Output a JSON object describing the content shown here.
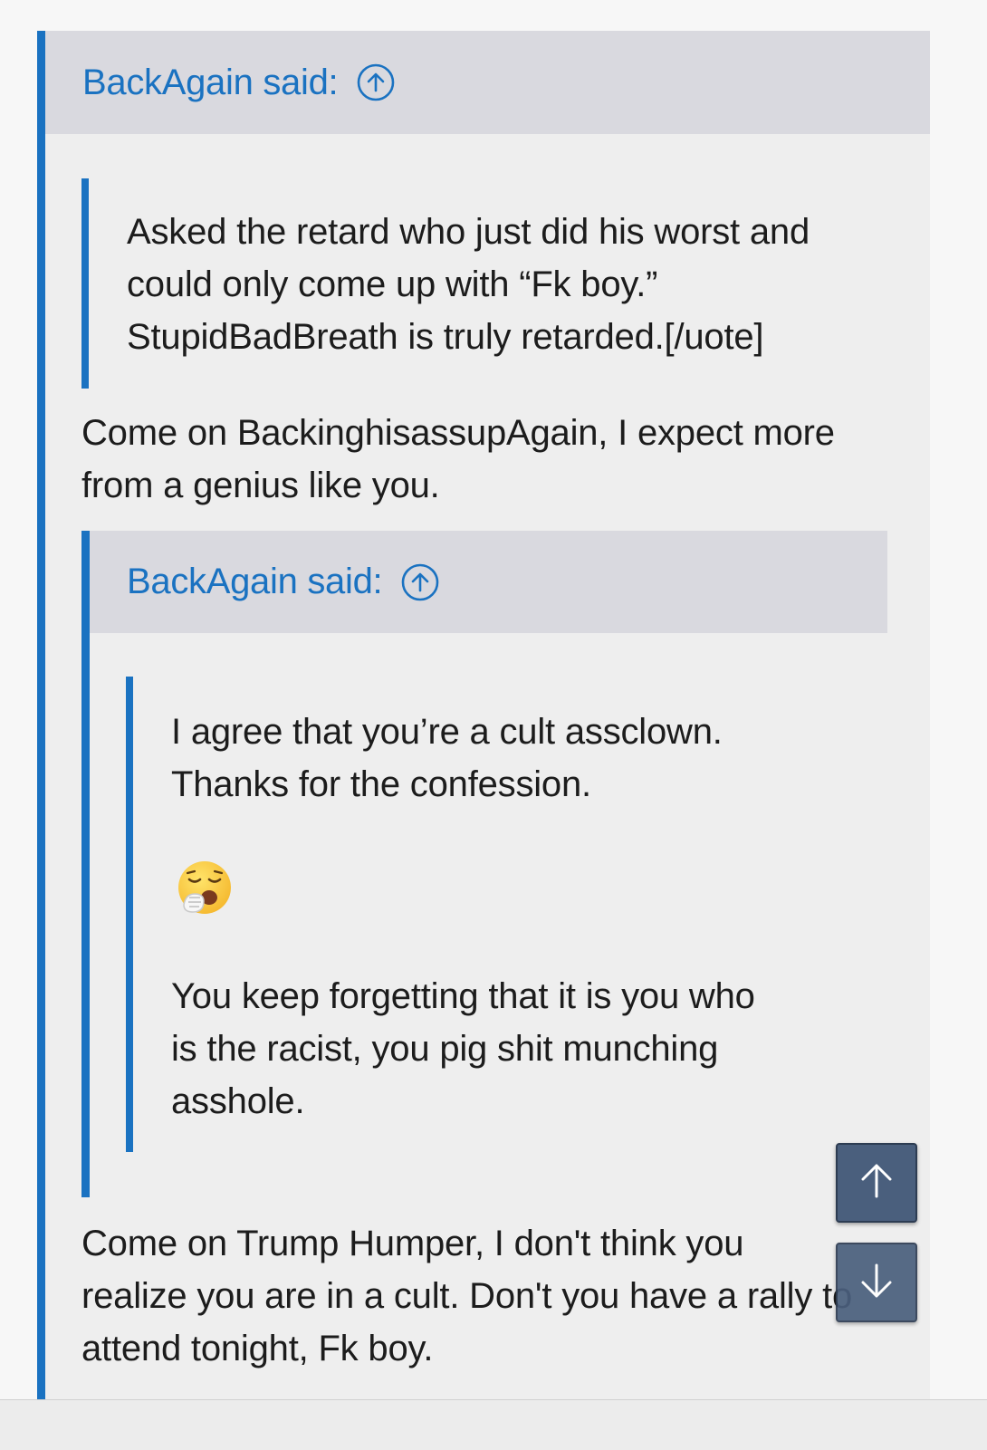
{
  "outer_quote": {
    "author_label": "BackAgain said:",
    "jump_icon": "arrow-up-circle-icon"
  },
  "inner_quote_1": {
    "text": "Asked the retard who just did his worst and\ncould only come up with “Fk boy.”\nStupidBadBreath is truly retarded.[/uote]"
  },
  "paragraph_1": "Come on BackinghisassupAgain, I expect more\nfrom a genius like you.",
  "nested_quote": {
    "author_label": "BackAgain said:",
    "jump_icon": "arrow-up-circle-icon",
    "inner": {
      "text_1": "I agree that you’re a cult assclown.\nThanks for the confession.",
      "emoji": "yawning-face-emoji",
      "text_2": "You keep forgetting that it is you who\nis the racist, you pig shit munching\nasshole."
    }
  },
  "paragraph_2": "Come on Trump Humper, I don't think you\nrealize you are in a cult. Don't you have a rally to\nattend tonight, Fk boy.",
  "scroll_buttons": {
    "up_icon": "arrow-up-icon",
    "down_icon": "arrow-down-icon"
  },
  "colors": {
    "accent": "#1a72c1",
    "quote_header_bg": "#d9d9df",
    "quote_bg": "#eeeeee",
    "scroll_button_bg": "#4a5f7d"
  }
}
